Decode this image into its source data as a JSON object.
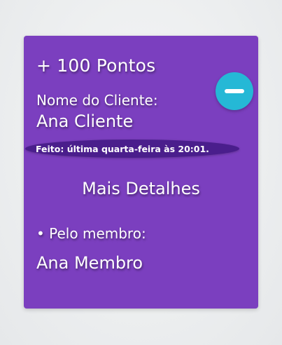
{
  "card": {
    "points": "+ 100 Pontos",
    "client_label": "Nome do Cliente:",
    "client_name": "Ana Cliente",
    "done_text": "Feito: última quarta-feira às 20:01.",
    "details_title": "Mais Detalhes",
    "member_label": "• Pelo membro:",
    "member_name": "Ana Membro",
    "toggle_icon": "minus-icon"
  },
  "colors": {
    "background": "#eceeef",
    "card": "#7b3fbf",
    "pill": "#4a1e8c",
    "toggle": "#25b8d6",
    "text": "#ffffff"
  }
}
